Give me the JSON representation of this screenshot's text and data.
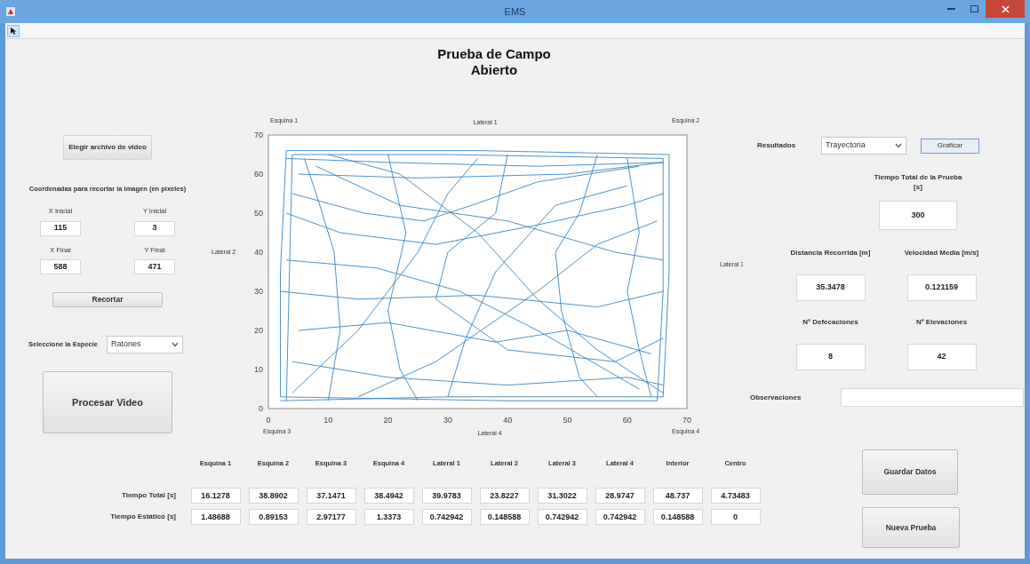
{
  "window": {
    "title": "EMS"
  },
  "heading": [
    "Prueba de Campo",
    "Abierto"
  ],
  "video_button": "Elegir archivo de video",
  "crop": {
    "caption": "Coordenadas para recortar la imagen (en pixeles)",
    "fields": [
      {
        "label": "X Inicial",
        "value": "115"
      },
      {
        "label": "Y Inicial",
        "value": "3"
      },
      {
        "label": "X Final",
        "value": "588"
      },
      {
        "label": "Y Final",
        "value": "471"
      }
    ],
    "button": "Recortar"
  },
  "species": {
    "label": "Seleccione la Especie",
    "value": "Ratones"
  },
  "process_button": "Procesar Video",
  "plot": {
    "y_ticks": [
      "70",
      "60",
      "50",
      "40",
      "30",
      "20",
      "10",
      "0"
    ],
    "x_ticks": [
      "0",
      "10",
      "20",
      "30",
      "40",
      "50",
      "60",
      "70"
    ],
    "top_labels": [
      "Esquina 1",
      "Lateral 1",
      "Esquina 2"
    ],
    "left_label": "Lateral 2",
    "right_label": "Lateral 3",
    "bottom_labels": [
      "Esquina 3",
      "Lateral 4",
      "Esquina 4"
    ]
  },
  "results": {
    "label": "Resultados",
    "value": "Trayectoria",
    "graph_button": "Graficar",
    "total_time": {
      "label": "Tiempo Total de la Prueba [s]",
      "value": "300"
    },
    "distance": {
      "label": "Distancia Recorrida [m]",
      "value": "35.3478"
    },
    "speed": {
      "label": "Velocidad Media [m/s]",
      "value": "0.121159"
    },
    "defecations": {
      "label": "Nº Defecaciones",
      "value": "8"
    },
    "elevations": {
      "label": "Nº Elevaciones",
      "value": "42"
    },
    "observations": {
      "label": "Observaciones"
    }
  },
  "table": {
    "columns": [
      "Esquina 1",
      "Esquina 2",
      "Esquina 3",
      "Esquina 4",
      "Lateral 1",
      "Lateral 2",
      "Lateral 3",
      "Lateral 4",
      "Interior",
      "Centro"
    ],
    "rows": [
      {
        "label": "Tiempo Total [s]",
        "values": [
          "16.1278",
          "38.8902",
          "37.1471",
          "38.4942",
          "39.9783",
          "23.8227",
          "31.3022",
          "28.9747",
          "48.737",
          "4.73483"
        ]
      },
      {
        "label": "Tiempo Estático [s]",
        "values": [
          "1.48688",
          "0.89153",
          "2.97177",
          "1.3373",
          "0.742942",
          "0.148588",
          "0.742942",
          "0.742942",
          "0.148588",
          "0"
        ]
      }
    ]
  },
  "save_button": "Guardar Datos",
  "new_test_button": "Nueva Prueba"
}
